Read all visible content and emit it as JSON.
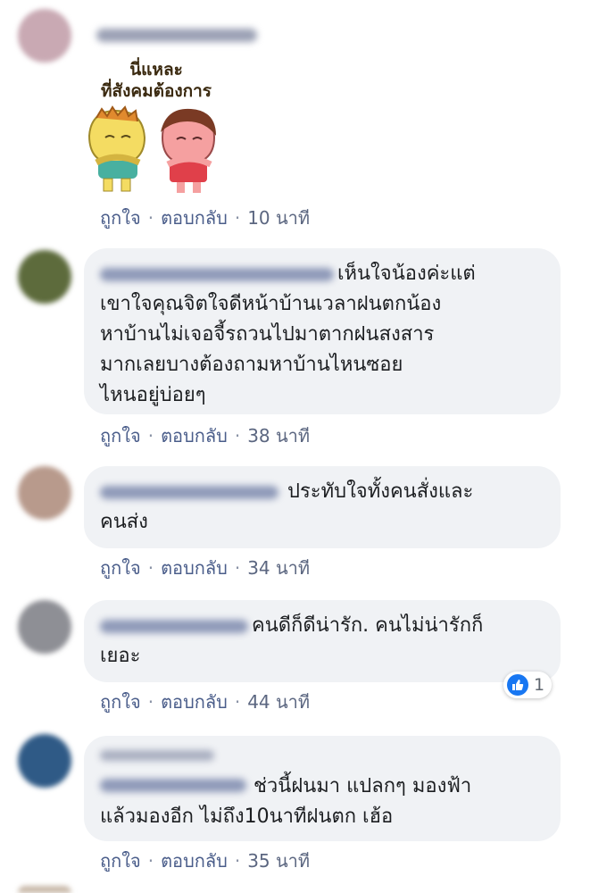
{
  "actions": {
    "like": "ถูกใจ",
    "reply": "ตอบกลับ",
    "separator": "·"
  },
  "comments": [
    {
      "avatar_color": "#c9a9b3",
      "sticker_text_1": "นี่แหละ",
      "sticker_text_2": "ที่สังคมต้องการ",
      "time": "10 นาที"
    },
    {
      "avatar_color": "#5d6b3c",
      "text": "เห็นใจน้องค่ะแต่\nเขาใจคุณจิตใจดีหน้าบ้านเวลาฝนตกน้อง\nหาบ้านไม่เจอจี้รถวนไปมาตากฝนสงสาร\nมากเลยบางต้องถามหาบ้านไหนซอย\nไหนอยู่บ่อยๆ",
      "time": "38 นาที"
    },
    {
      "avatar_color": "#b89a8c",
      "text": "ประทับใจทั้งคนสั่งและ\nคนส่ง",
      "time": "34 นาที"
    },
    {
      "avatar_color": "#8e8f95",
      "text": "คนดีก็ดีน่ารัก. คนไม่น่ารักก็\nเยอะ",
      "time": "44 นาที",
      "reaction_count": "1"
    },
    {
      "avatar_color": "#2f5a86",
      "text": "ช่วนี้ฝนมา แปลกๆ มองฟ้า\nแล้วมองอีก ไม่ถึง10นาทีฝนตก เฮ้อ",
      "time": "35 นาที"
    }
  ]
}
